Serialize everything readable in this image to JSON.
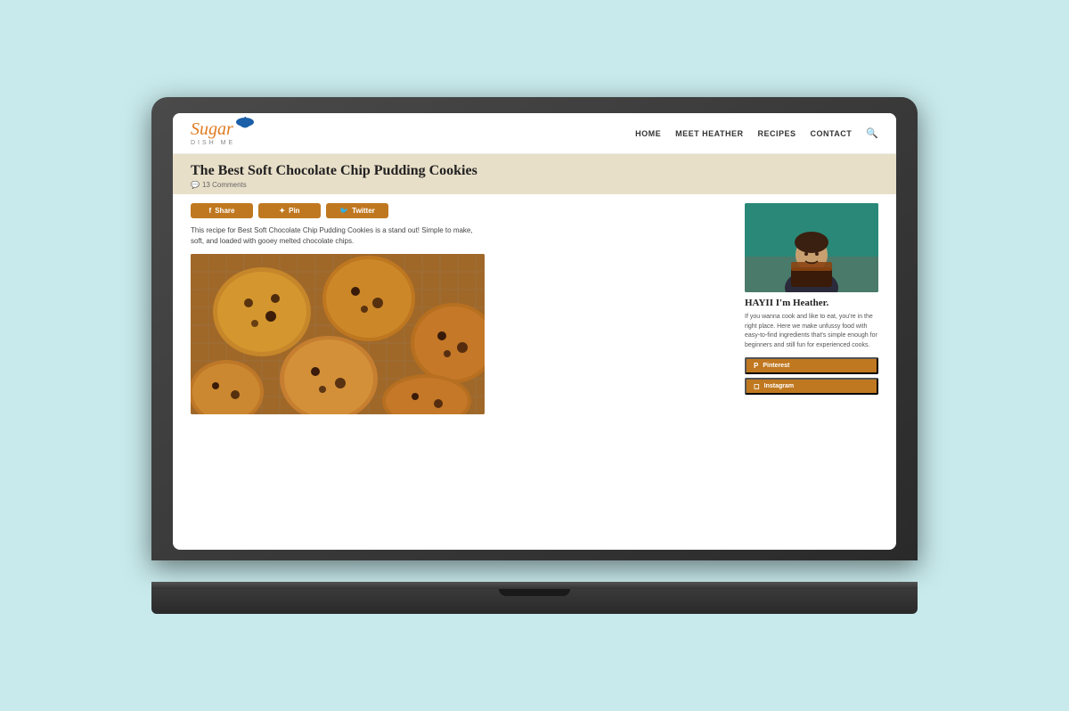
{
  "laptop": {
    "screen_bg": "#fff"
  },
  "site": {
    "logo": {
      "brand": "Sugar",
      "subtitle": "DISH ME",
      "bowl_color": "#1a5fa8"
    },
    "nav": {
      "items": [
        {
          "label": "HOME",
          "id": "home"
        },
        {
          "label": "MEET HEATHER",
          "id": "meet-heather"
        },
        {
          "label": "RECIPES",
          "id": "recipes"
        },
        {
          "label": "CONTACT",
          "id": "contact"
        }
      ]
    },
    "article": {
      "title": "The Best Soft Chocolate Chip Pudding Cookies",
      "comments": "13 Comments",
      "intro": "This recipe for Best Soft Chocolate Chip Pudding Cookies is a stand out! Simple to make, soft, and loaded with gooey melted chocolate chips.",
      "share_buttons": [
        {
          "label": "Share",
          "icon": "f",
          "id": "facebook"
        },
        {
          "label": "Pin",
          "icon": "p",
          "id": "pinterest"
        },
        {
          "label": "Twitter",
          "icon": "t",
          "id": "twitter"
        }
      ]
    },
    "sidebar": {
      "greeting": "HAYII I'm Heather.",
      "bio": "If you wanna cook and like to eat, you're in the right place. Here we make unfussy food with easy-to-find ingredients that's simple enough for beginners and still fun for experienced cooks.",
      "social": [
        {
          "label": "Pinterest",
          "icon": "P",
          "id": "pinterest"
        },
        {
          "label": "Instagram",
          "icon": "I",
          "id": "instagram"
        }
      ]
    }
  }
}
